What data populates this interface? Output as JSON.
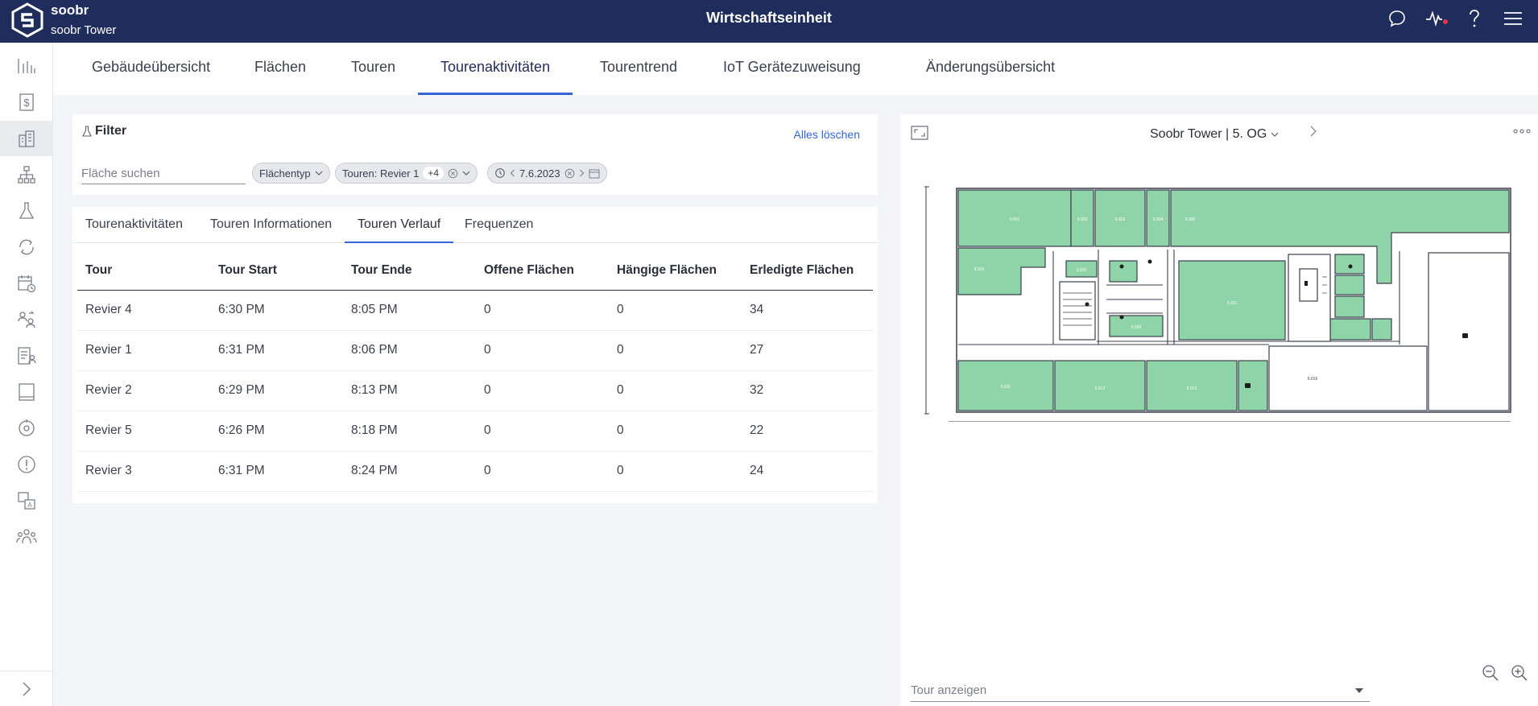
{
  "app": {
    "brand": "soobr",
    "building": "soobr Tower",
    "title": "Wirtschaftseinheit"
  },
  "colors": {
    "topbar": "#1f2d5c",
    "accent": "#3565d8",
    "room_fill": "#8fd4a8",
    "status_dot": "#e8344a"
  },
  "topbar_icons": [
    "chat-icon",
    "activity-icon",
    "help-icon",
    "menu-icon"
  ],
  "sidebar": {
    "items": [
      {
        "icon": "bar-chart-icon"
      },
      {
        "icon": "dollar-document-icon"
      },
      {
        "icon": "building-icon",
        "active": true
      },
      {
        "icon": "hierarchy-icon"
      },
      {
        "icon": "flask-icon"
      },
      {
        "icon": "cycle-icon"
      },
      {
        "icon": "calendar-clock-icon"
      },
      {
        "icon": "person-swap-icon"
      },
      {
        "icon": "document-person-icon"
      },
      {
        "icon": "tablet-icon"
      },
      {
        "icon": "target-icon"
      },
      {
        "icon": "alert-icon"
      },
      {
        "icon": "translate-icon"
      },
      {
        "icon": "team-icon"
      }
    ],
    "expand_icon": "chevron-right-icon"
  },
  "main_tabs": [
    {
      "label": "Gebäudeübersicht"
    },
    {
      "label": "Flächen"
    },
    {
      "label": "Touren"
    },
    {
      "label": "Tourenaktivitäten",
      "active": true
    },
    {
      "label": "Tourentrend"
    },
    {
      "label": "IoT Gerätezuweisung"
    },
    {
      "label": "Änderungsübersicht"
    }
  ],
  "filter": {
    "title": "Filter",
    "clear_all": "Alles löschen",
    "search_placeholder": "Fläche suchen",
    "chips": {
      "area_type": "Flächentyp",
      "tours_label": "Touren: Revier 1",
      "tours_more": "+4",
      "date": "7.6.2023"
    }
  },
  "sub_tabs": [
    {
      "label": "Tourenaktivitäten"
    },
    {
      "label": "Touren Informationen"
    },
    {
      "label": "Touren Verlauf",
      "active": true
    },
    {
      "label": "Frequenzen"
    }
  ],
  "table": {
    "headers": [
      "Tour",
      "Tour Start",
      "Tour Ende",
      "Offene Flächen",
      "Hängige Flächen",
      "Erledigte Flächen"
    ],
    "rows": [
      [
        "Revier 4",
        "6:30 PM",
        "8:05 PM",
        "0",
        "0",
        "34"
      ],
      [
        "Revier 1",
        "6:31 PM",
        "8:06 PM",
        "0",
        "0",
        "27"
      ],
      [
        "Revier 2",
        "6:29 PM",
        "8:13 PM",
        "0",
        "0",
        "32"
      ],
      [
        "Revier 5",
        "6:26 PM",
        "8:18 PM",
        "0",
        "0",
        "22"
      ],
      [
        "Revier 3",
        "6:31 PM",
        "8:24 PM",
        "0",
        "0",
        "24"
      ]
    ]
  },
  "map": {
    "title": "Soobr Tower | 5. OG",
    "tour_select_placeholder": "Tour anzeigen",
    "rooms": [
      {
        "label": "5.001"
      },
      {
        "label": "5.002"
      },
      {
        "label": "5.003"
      },
      {
        "label": "5.004"
      },
      {
        "label": "5.005"
      },
      {
        "label": "5.010"
      },
      {
        "label": "5.011"
      },
      {
        "label": "5.012"
      },
      {
        "label": "5.013"
      },
      {
        "label": "5.020"
      },
      {
        "label": "5.021"
      },
      {
        "label": "5.030"
      },
      {
        "label": "5.016"
      }
    ]
  }
}
